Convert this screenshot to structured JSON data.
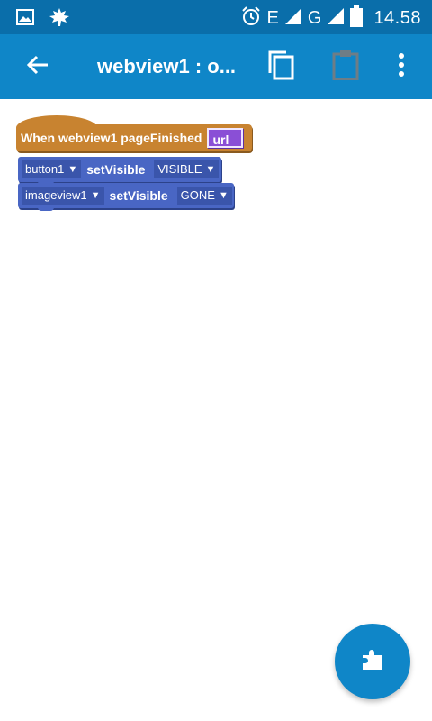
{
  "status_bar": {
    "time": "14.58",
    "network_1": "E",
    "network_2": "G",
    "icons": [
      "image-icon",
      "leaf-icon",
      "alarm-icon",
      "signal-icon",
      "battery-icon"
    ]
  },
  "app_bar": {
    "title": "webview1 : o...",
    "icons": [
      "back-arrow-icon",
      "copy-icon",
      "paste-icon",
      "more-vert-icon"
    ]
  },
  "blocks": {
    "event": {
      "label": "When  webview1  pageFinished",
      "param": "url"
    },
    "statements": [
      {
        "component": "button1",
        "method": "setVisible",
        "value": "VISIBLE"
      },
      {
        "component": "imageview1",
        "method": "setVisible",
        "value": "GONE"
      }
    ]
  },
  "fab": {
    "icon": "puzzle-icon"
  },
  "colors": {
    "status_bar": "#0a6eaa",
    "app_bar": "#0f86c8",
    "event_block": "#c88330",
    "statement_block": "#4966c4",
    "param_block": "#8a4fd6"
  }
}
